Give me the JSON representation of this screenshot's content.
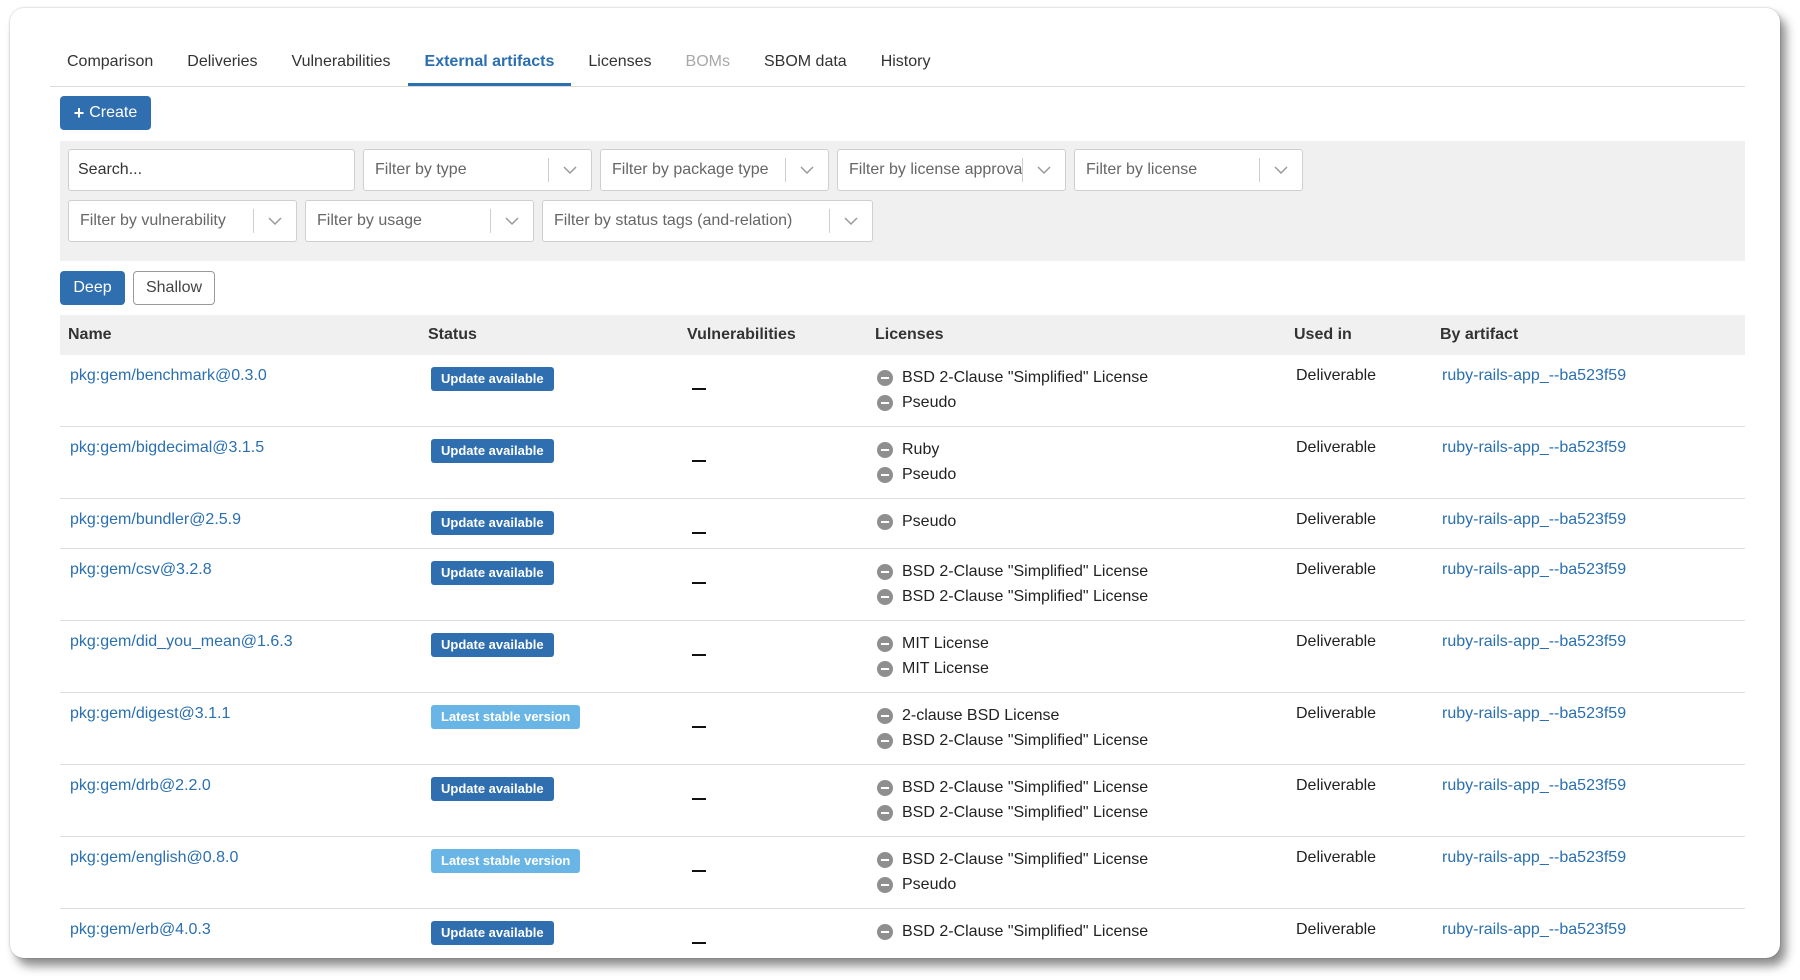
{
  "tabs": [
    {
      "label": "Comparison",
      "state": "normal"
    },
    {
      "label": "Deliveries",
      "state": "normal"
    },
    {
      "label": "Vulnerabilities",
      "state": "normal"
    },
    {
      "label": "External artifacts",
      "state": "active"
    },
    {
      "label": "Licenses",
      "state": "normal"
    },
    {
      "label": "BOMs",
      "state": "disabled"
    },
    {
      "label": "SBOM data",
      "state": "normal"
    },
    {
      "label": "History",
      "state": "normal"
    }
  ],
  "toolbar": {
    "create_label": "Create",
    "create_icon": "plus-icon"
  },
  "filters": {
    "search_placeholder": "Search...",
    "type": "Filter by type",
    "package_type": "Filter by package type",
    "license_approval": "Filter by license approval",
    "license": "Filter by license",
    "vulnerability": "Filter by vulnerability",
    "usage": "Filter by usage",
    "status_tags": "Filter by status tags (and-relation)"
  },
  "view_toggle": {
    "deep": "Deep",
    "shallow": "Shallow",
    "selected": "Deep"
  },
  "table": {
    "columns": {
      "name": "Name",
      "status": "Status",
      "vulnerabilities": "Vulnerabilities",
      "licenses": "Licenses",
      "used_in": "Used in",
      "by_artifact": "By artifact"
    },
    "rows": [
      {
        "name": "pkg:gem/benchmark@0.3.0",
        "status": "Update available",
        "status_kind": "update",
        "licenses": [
          "BSD 2-Clause \"Simplified\" License",
          "Pseudo"
        ],
        "used_in": "Deliverable",
        "artifact": "ruby-rails-app_--ba523f59"
      },
      {
        "name": "pkg:gem/bigdecimal@3.1.5",
        "status": "Update available",
        "status_kind": "update",
        "licenses": [
          "Ruby",
          "Pseudo"
        ],
        "used_in": "Deliverable",
        "artifact": "ruby-rails-app_--ba523f59"
      },
      {
        "name": "pkg:gem/bundler@2.5.9",
        "status": "Update available",
        "status_kind": "update",
        "licenses": [
          "Pseudo"
        ],
        "used_in": "Deliverable",
        "artifact": "ruby-rails-app_--ba523f59"
      },
      {
        "name": "pkg:gem/csv@3.2.8",
        "status": "Update available",
        "status_kind": "update",
        "licenses": [
          "BSD 2-Clause \"Simplified\" License",
          "BSD 2-Clause \"Simplified\" License"
        ],
        "used_in": "Deliverable",
        "artifact": "ruby-rails-app_--ba523f59"
      },
      {
        "name": "pkg:gem/did_you_mean@1.6.3",
        "status": "Update available",
        "status_kind": "update",
        "licenses": [
          "MIT License",
          "MIT License"
        ],
        "used_in": "Deliverable",
        "artifact": "ruby-rails-app_--ba523f59"
      },
      {
        "name": "pkg:gem/digest@3.1.1",
        "status": "Latest stable version",
        "status_kind": "latest",
        "licenses": [
          "2-clause BSD License",
          "BSD 2-Clause \"Simplified\" License"
        ],
        "used_in": "Deliverable",
        "artifact": "ruby-rails-app_--ba523f59"
      },
      {
        "name": "pkg:gem/drb@2.2.0",
        "status": "Update available",
        "status_kind": "update",
        "licenses": [
          "BSD 2-Clause \"Simplified\" License",
          "BSD 2-Clause \"Simplified\" License"
        ],
        "used_in": "Deliverable",
        "artifact": "ruby-rails-app_--ba523f59"
      },
      {
        "name": "pkg:gem/english@0.8.0",
        "status": "Latest stable version",
        "status_kind": "latest",
        "licenses": [
          "BSD 2-Clause \"Simplified\" License",
          "Pseudo"
        ],
        "used_in": "Deliverable",
        "artifact": "ruby-rails-app_--ba523f59"
      },
      {
        "name": "pkg:gem/erb@4.0.3",
        "status": "Update available",
        "status_kind": "update",
        "licenses": [
          "BSD 2-Clause \"Simplified\" License"
        ],
        "used_in": "Deliverable",
        "artifact": "ruby-rails-app_--ba523f59"
      }
    ],
    "vulnerability_placeholder": "—"
  },
  "colors": {
    "accent": "#2f6fb0",
    "link": "#2a6fb0",
    "latest_badge": "#69b6e6",
    "panel": "#f0f0f0"
  }
}
